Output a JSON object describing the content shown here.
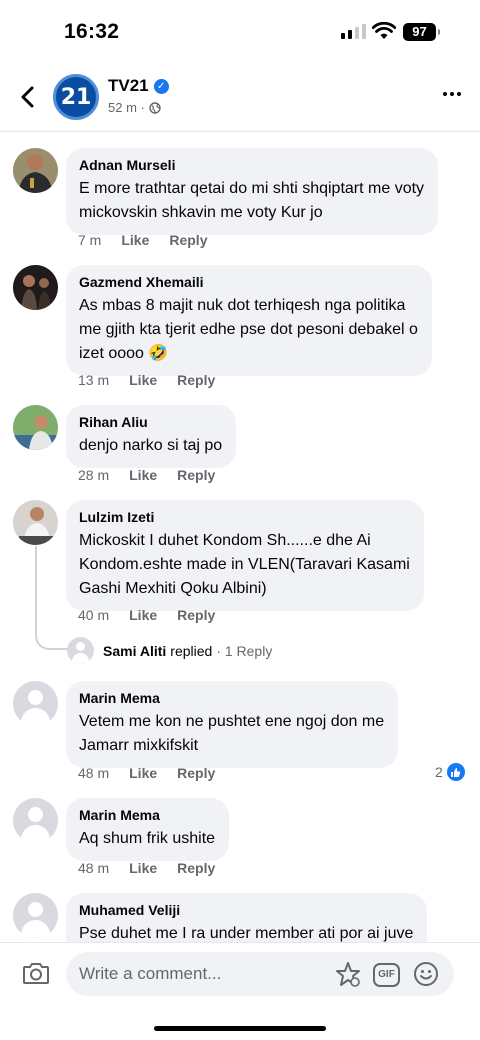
{
  "status_bar": {
    "time": "16:32",
    "battery": "97"
  },
  "header": {
    "page_name": "TV21",
    "logo_text": "21",
    "meta": "52 m ·"
  },
  "comments": [
    {
      "author": "Adnan Murseli",
      "text": "E more trathtar qetai do mi shti shqiptart me voty\nmickovskin shkavin me voty Kur jo",
      "time": "7 m",
      "like": "Like",
      "reply": "Reply"
    },
    {
      "author": "Gazmend Xhemaili",
      "text": "As mbas 8 majit nuk dot terhiqesh nga politika\nme gjith kta tjerit edhe pse dot pesoni debakel o\nizet oooo 🤣",
      "time": "13 m",
      "like": "Like",
      "reply": "Reply"
    },
    {
      "author": "Rihan Aliu",
      "text": "denjo narko si taj po",
      "time": "28 m",
      "like": "Like",
      "reply": "Reply"
    },
    {
      "author": "Lulzim Izeti",
      "text": "Mickoskit I duhet Kondom Sh......e dhe Ai\nKondom.eshte made in VLEN(Taravari Kasami\nGashi Mexhiti Qoku Albini)",
      "time": "40 m",
      "like": "Like",
      "reply": "Reply"
    },
    {
      "author": "Marin Mema",
      "text": "Vetem me kon ne pushtet ene ngoj don me\nJamarr mixkifskit",
      "time": "48 m",
      "like": "Like",
      "reply": "Reply",
      "likes": "2"
    },
    {
      "author": "Marin Mema",
      "text": "Aq shum frik ushite",
      "time": "48 m",
      "like": "Like",
      "reply": "Reply"
    },
    {
      "author": "Muhamed Veliji",
      "text": "Pse duhet me I ra under member ati por ai juve"
    }
  ],
  "reply_thread": {
    "name": "Sami Aliti",
    "verb": "replied",
    "count": "· 1 Reply"
  },
  "composer": {
    "placeholder": "Write a comment...",
    "gif_label": "GIF"
  },
  "colors": {
    "accent": "#1877f2",
    "bubble": "#f0f2f5",
    "muted": "#65676b"
  }
}
